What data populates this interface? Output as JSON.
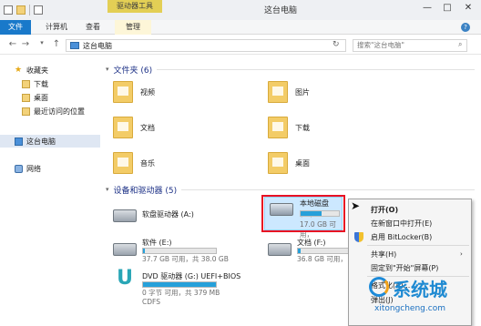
{
  "window": {
    "title": "这台电脑",
    "context_tab": "驱动器工具",
    "minimize": "—",
    "maximize": "□",
    "close": "✕"
  },
  "ribbon": {
    "tabs": [
      "文件",
      "计算机",
      "查看",
      "管理"
    ],
    "help": "?"
  },
  "address": {
    "back": "←",
    "forward": "→",
    "up": "↑",
    "path": "这台电脑",
    "search_placeholder": "搜索\"这台电脑\"",
    "refresh": "↻",
    "search_icon": "⌕"
  },
  "nav": {
    "favorites": "收藏夹",
    "download": "下载",
    "desktop": "桌面",
    "recent": "最近访问的位置",
    "this_pc": "这台电脑",
    "network": "网络"
  },
  "folders": {
    "header": "文件夹 (6)",
    "items": [
      "视频",
      "图片",
      "文档",
      "下载",
      "音乐",
      "桌面"
    ]
  },
  "drives": {
    "header": "设备和驱动器 (5)",
    "items": [
      {
        "name": "软盘驱动器 (A:)",
        "free": "",
        "fill": 0
      },
      {
        "name": "本地磁盘 (C:)",
        "free": "17.0 GB 可用，",
        "fill": 0.55
      },
      {
        "name": "软件 (E:)",
        "free": "37.7 GB 可用，共 38.0 GB",
        "fill": 0.02
      },
      {
        "name": "文档 (F:)",
        "free": "36.8 GB 可用，",
        "fill": 0.05
      },
      {
        "name": "DVD 驱动器 (G:) UEFI+BIOS",
        "free": "0 字节 可用，共 379 MB",
        "fs": "CDFS",
        "fill": 1
      }
    ]
  },
  "context_menu": [
    "打开(O)",
    "在新窗口中打开(E)",
    "启用 BitLocker(B)",
    "共享(H)",
    "固定到\"开始\"屏幕(P)",
    "格式化(A)...",
    "弹出(J)"
  ],
  "watermark": {
    "brand": "系统城",
    "url": "xitongcheng.com"
  },
  "colors": {
    "accent": "#1979ca",
    "drive_tools": "#e3cf55",
    "highlight_red": "#e81123"
  }
}
